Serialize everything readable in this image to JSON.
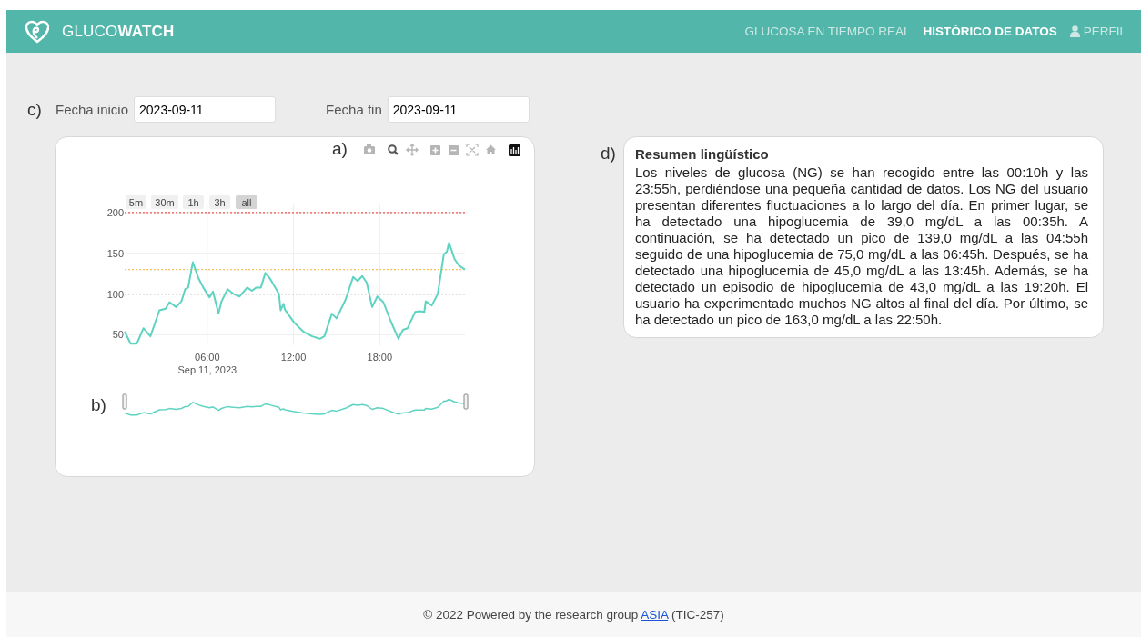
{
  "header": {
    "brand": "GLUCO**WATCH**",
    "nav": [
      {
        "label": "GLUCOSA EN TIEMPO REAL",
        "selected": false,
        "kind": "link"
      },
      {
        "label": "HISTÓRICO DE DATOS",
        "selected": true,
        "kind": "link"
      },
      {
        "label": "PERFIL",
        "selected": false,
        "kind": "profile"
      }
    ]
  },
  "filters": {
    "marker": "c)",
    "fields": [
      {
        "label": "Fecha inicio",
        "value": "2023-09-11"
      },
      {
        "label": "Fecha fin",
        "value": "2023-09-11"
      }
    ]
  },
  "chart": {
    "marker": "a)",
    "slider_marker": "b)",
    "range_buttons": [
      {
        "label": "5m",
        "selected": false
      },
      {
        "label": "30m",
        "selected": false
      },
      {
        "label": "1h",
        "selected": false
      },
      {
        "label": "3h",
        "selected": false
      },
      {
        "label": "all",
        "selected": true
      }
    ],
    "chart_data": {
      "type": "line",
      "xlim": [
        0.25,
        23.93
      ],
      "ylim": [
        37,
        210
      ],
      "xticks": [
        {
          "value": 6,
          "label": "06:00"
        },
        {
          "value": 12,
          "label": "12:00"
        },
        {
          "value": 18,
          "label": "18:00"
        }
      ],
      "grid": true,
      "yticks": [
        50,
        100,
        150,
        200
      ],
      "x": [
        0.25,
        0.67,
        1.1,
        1.56,
        2.04,
        2.67,
        3.1,
        3.37,
        3.83,
        4.2,
        4.46,
        4.67,
        4.99,
        5.4,
        5.72,
        6.15,
        6.4,
        6.78,
        6.99,
        7.41,
        7.83,
        8.25,
        8.78,
        9.1,
        9.41,
        9.73,
        10.04,
        10.36,
        10.99,
        11.1,
        11.3,
        11.4,
        12.04,
        12.67,
        13.3,
        13.83,
        14.15,
        14.67,
        14.99,
        15.62,
        16.15,
        16.46,
        16.78,
        17.09,
        17.47,
        17.83,
        18.25,
        18.78,
        19.3,
        19.62,
        19.94,
        20.46,
        20.78,
        21.1,
        21.2,
        21.62,
        22.04,
        22.46,
        22.67,
        22.82,
        23.2,
        23.51,
        23.93
      ],
      "series": [
        {
          "color": "#5fd3c1",
          "values": [
            54,
            39,
            39,
            58,
            48,
            80,
            82,
            90,
            84,
            91,
            106,
            108,
            139,
            119,
            108,
            96,
            103,
            76,
            91,
            106,
            100,
            97,
            108,
            104,
            108,
            108,
            126,
            119,
            100,
            80,
            88,
            81,
            65,
            54,
            48,
            45,
            48,
            76,
            70,
            93,
            121,
            116,
            122,
            114,
            84,
            97,
            90,
            66,
            45,
            56,
            58,
            78,
            79,
            78,
            91,
            86,
            100,
            149,
            152,
            163,
            143,
            135,
            130
          ]
        }
      ],
      "ref_lines": [
        {
          "axis": "y",
          "value": 200,
          "color": "#f0544f"
        },
        {
          "axis": "y",
          "value": 130,
          "color": "#f5c15a"
        },
        {
          "axis": "y",
          "value": 100,
          "color": "#8a8a8a"
        }
      ]
    },
    "date_label": "Sep 11, 2023"
  },
  "summary": {
    "marker": "d)",
    "title": "Resumen lingüístico",
    "text": "Los niveles de glucosa (NG) se han recogido entre las 00:10h y las 23:55h, perdiéndose una pequeña cantidad de datos. Los NG del usuario presentan diferentes fluctuaciones a lo largo del día. En primer lugar, se ha detectado una hipoglucemia de 39,0 mg/dL a las 00:35h. A continuación, se ha detectado un pico de 139,0 mg/dL a las 04:55h seguido de una hipoglucemia de 75,0 mg/dL a las 06:45h. Después, se ha detectado una hipoglucemia de 45,0 mg/dL a las 13:45h. Además, se ha detectado un episodio de hipoglucemia de 43,0 mg/dL a las 19:20h. El usuario ha experimentado muchos NG altos al final del día. Por último, se ha detectado un pico de 163,0 mg/dL a las 22:50h."
  },
  "footer": {
    "text_before": "© 2022 Powered by the research group",
    "link": "ASIA",
    "text_after": "(TIC-257)"
  }
}
